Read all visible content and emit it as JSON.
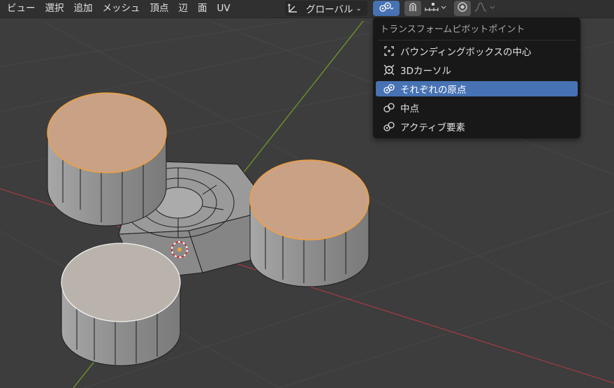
{
  "menu": {
    "items": [
      "ビュー",
      "選択",
      "追加",
      "メッシュ",
      "頂点",
      "辺",
      "面",
      "UV"
    ]
  },
  "transform_orientation": {
    "label": "グローバル",
    "icon": "transform-orientation-icon"
  },
  "toolbar": {
    "pivot_icon": "pivot-individual-origins-icon",
    "snap_icon": "snap-magnet-icon",
    "snap_type_icon": "snap-increment-icon",
    "proportional_icon": "proportional-editing-icon",
    "falloff_icon": "falloff-curve-icon"
  },
  "pivot_menu": {
    "title": "トランスフォームピボットポイント",
    "items": [
      {
        "label": "バウンディングボックスの中心",
        "icon": "bounding-box-center-icon",
        "selected": false
      },
      {
        "label": "3Dカーソル",
        "icon": "3d-cursor-icon",
        "selected": false
      },
      {
        "label": "それぞれの原点",
        "icon": "individual-origins-icon",
        "selected": true
      },
      {
        "label": "中点",
        "icon": "median-point-icon",
        "selected": false
      },
      {
        "label": "アクティブ要素",
        "icon": "active-element-icon",
        "selected": false
      }
    ]
  },
  "colors": {
    "viewport_bg": "#3d3d3d",
    "header_bg": "#303030",
    "menu_bg": "#181818",
    "accent": "#4772b3",
    "x_axis": "#a03a44",
    "y_axis": "#6d9a24",
    "selected_face": "#c9a185",
    "selected_edge": "#f0a040",
    "unselected_top": "#b9b3ab",
    "mesh_side": "#8e8e8e"
  }
}
